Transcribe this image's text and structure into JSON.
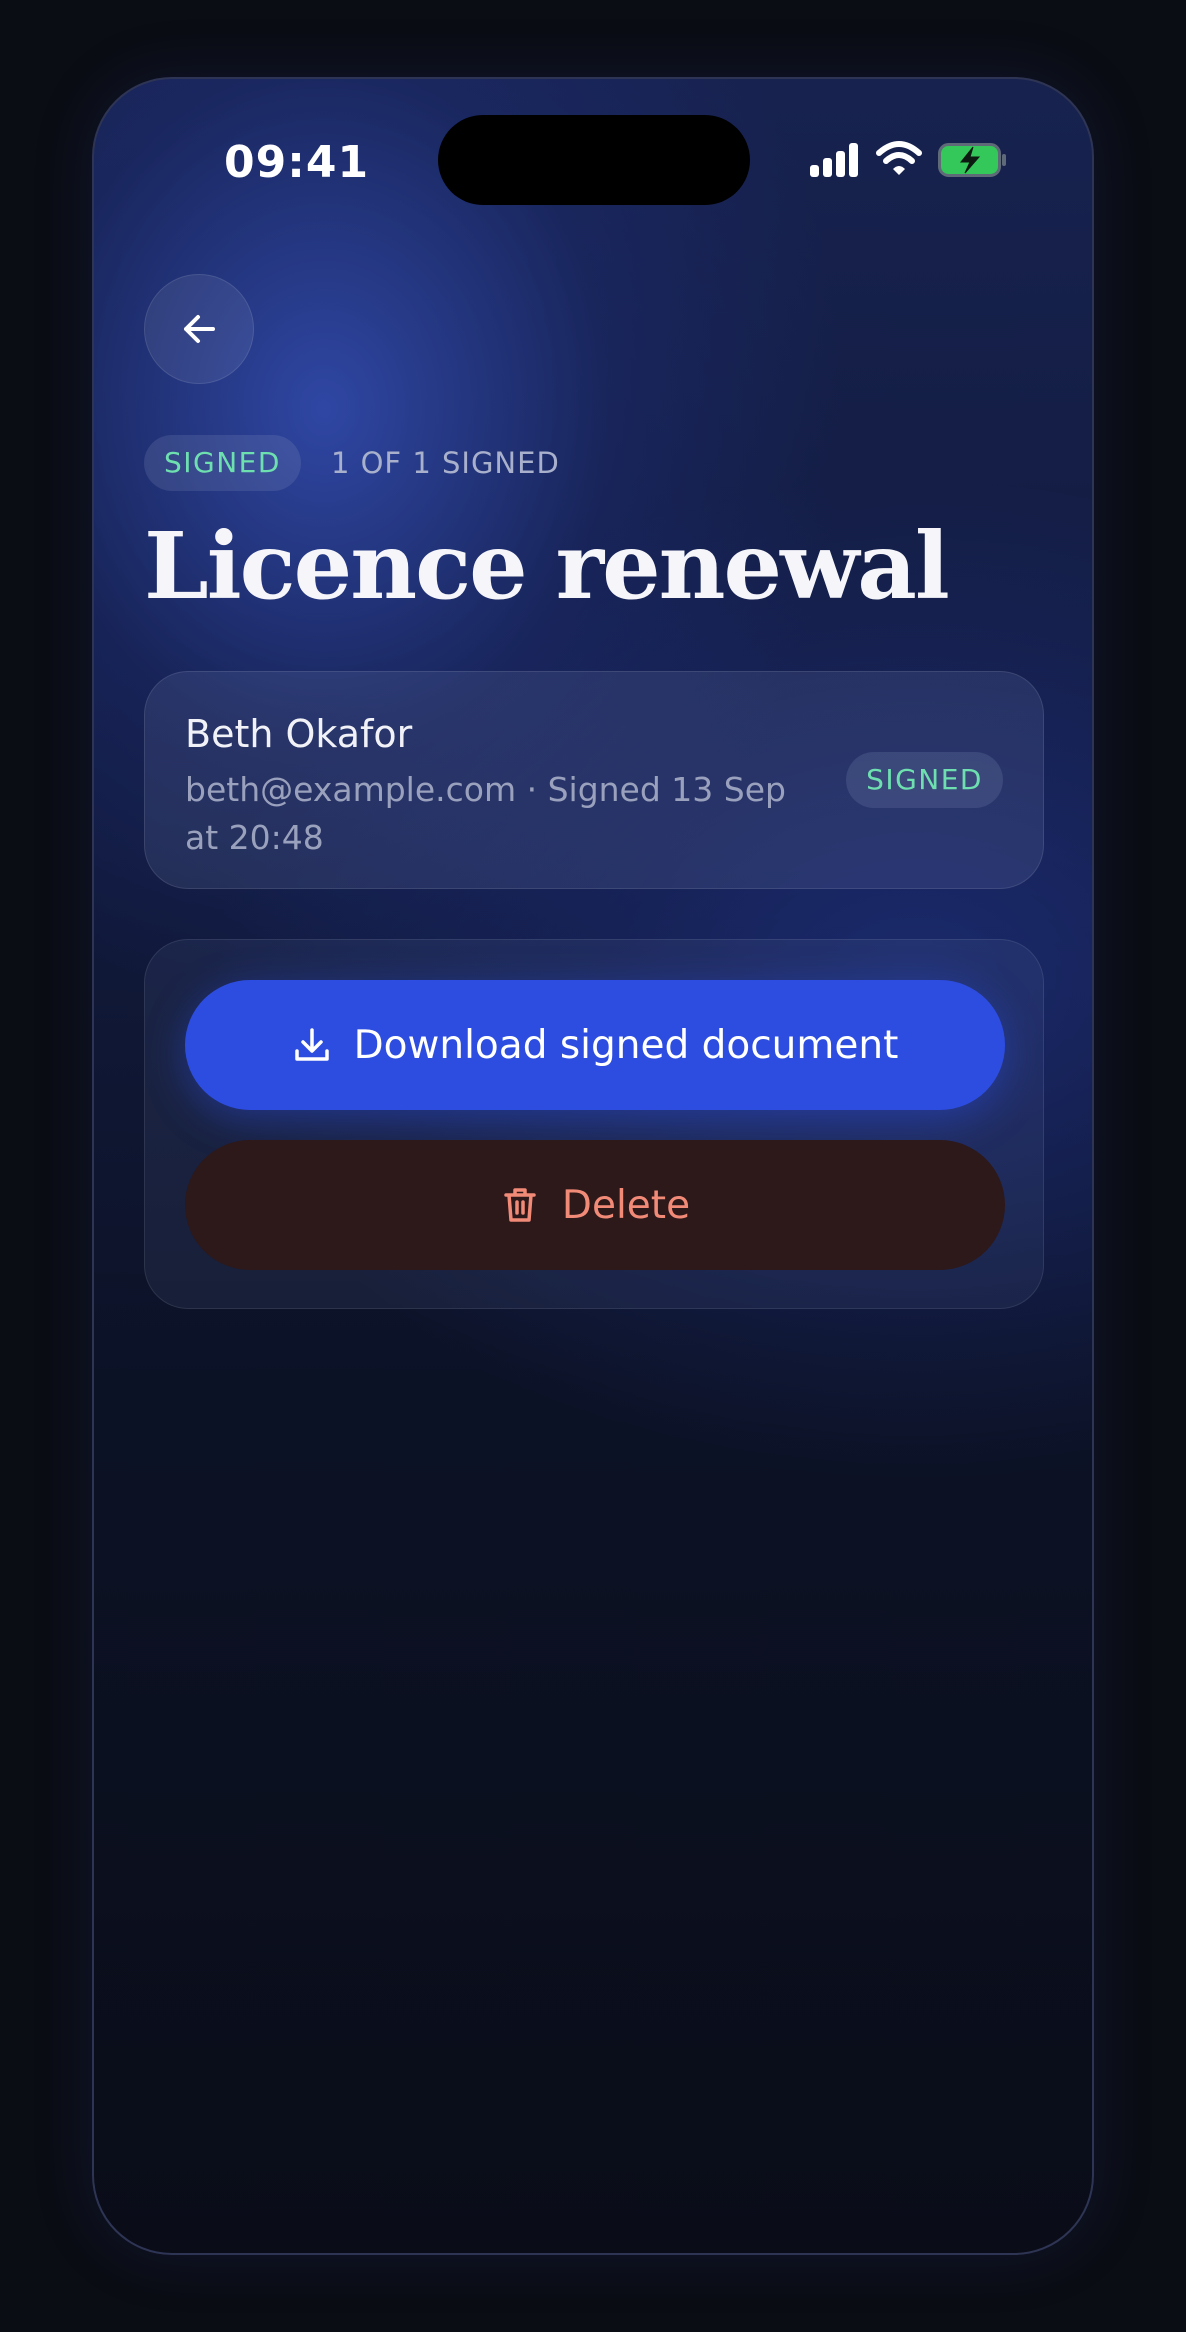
{
  "status_bar": {
    "time": "09:41"
  },
  "document": {
    "status_badge": "SIGNED",
    "signed_count": "1 OF 1 SIGNED",
    "title": "Licence renewal"
  },
  "signer": {
    "name": "Beth Okafor",
    "detail": "beth@example.com · Signed 13 Sep at 20:48",
    "status": "SIGNED"
  },
  "actions": {
    "download_label": "Download signed document",
    "delete_label": "Delete"
  },
  "icons": {
    "back": "arrow-left-icon",
    "download": "download-icon",
    "delete": "trash-icon",
    "signal": "cellular-signal-icon",
    "wifi": "wifi-icon",
    "battery": "battery-charging-icon"
  },
  "colors": {
    "accent": "#2d4de0",
    "success": "#6ee0b0",
    "danger": "#f28a78",
    "battery": "#34c759"
  }
}
